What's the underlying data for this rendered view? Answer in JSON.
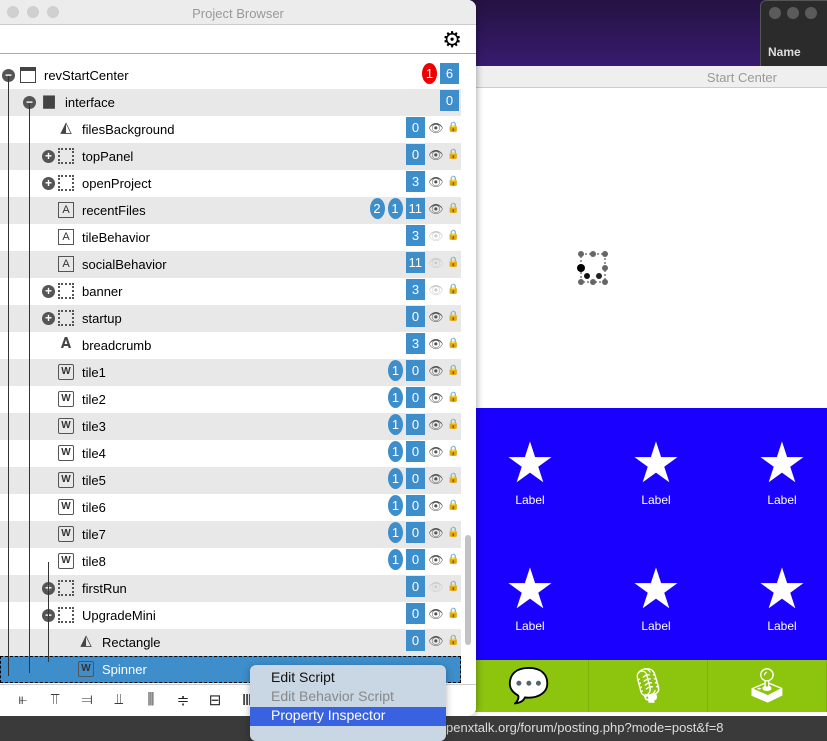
{
  "project_browser": {
    "title": "Project Browser",
    "settings_icon": "gear-icon",
    "rows": [
      {
        "name": "revStartCenter",
        "level": 0,
        "toggle": "minus",
        "icon": "card",
        "overlays": [
          {
            "v": "1",
            "color": "#e00000"
          }
        ],
        "count": "6",
        "eye": null
      },
      {
        "name": "interface",
        "level": 1,
        "toggle": "minus",
        "icon": "folder",
        "overlays": [],
        "count": "0",
        "eye": null
      },
      {
        "name": "filesBackground",
        "level": 2,
        "toggle": null,
        "icon": "image",
        "overlays": [],
        "count": "0",
        "eye": "visible"
      },
      {
        "name": "topPanel",
        "level": 2,
        "toggle": "plus",
        "icon": "group",
        "overlays": [],
        "count": "0",
        "eye": "visible"
      },
      {
        "name": "openProject",
        "level": 2,
        "toggle": "plus",
        "icon": "group",
        "overlays": [],
        "count": "3",
        "eye": "visible"
      },
      {
        "name": "recentFiles",
        "level": 2,
        "toggle": null,
        "icon": "field",
        "overlays": [
          {
            "v": "2"
          },
          {
            "v": "1"
          }
        ],
        "count": "11",
        "eye": "visible"
      },
      {
        "name": "tileBehavior",
        "level": 2,
        "toggle": null,
        "icon": "field",
        "overlays": [],
        "count": "3",
        "eye": "hidden"
      },
      {
        "name": "socialBehavior",
        "level": 2,
        "toggle": null,
        "icon": "field",
        "overlays": [],
        "count": "11",
        "eye": "hidden"
      },
      {
        "name": "banner",
        "level": 2,
        "toggle": "plus",
        "icon": "group",
        "overlays": [],
        "count": "3",
        "eye": "hidden"
      },
      {
        "name": "startup",
        "level": 2,
        "toggle": "plus",
        "icon": "group",
        "overlays": [],
        "count": "0",
        "eye": "visible"
      },
      {
        "name": "breadcrumb",
        "level": 2,
        "toggle": null,
        "icon": "text",
        "overlays": [],
        "count": "3",
        "eye": "visible"
      },
      {
        "name": "tile1",
        "level": 2,
        "toggle": null,
        "icon": "widget",
        "overlays": [
          {
            "v": "1"
          }
        ],
        "count": "0",
        "eye": "visible"
      },
      {
        "name": "tile2",
        "level": 2,
        "toggle": null,
        "icon": "widget",
        "overlays": [
          {
            "v": "1"
          }
        ],
        "count": "0",
        "eye": "visible"
      },
      {
        "name": "tile3",
        "level": 2,
        "toggle": null,
        "icon": "widget",
        "overlays": [
          {
            "v": "1"
          }
        ],
        "count": "0",
        "eye": "visible"
      },
      {
        "name": "tile4",
        "level": 2,
        "toggle": null,
        "icon": "widget",
        "overlays": [
          {
            "v": "1"
          }
        ],
        "count": "0",
        "eye": "visible"
      },
      {
        "name": "tile5",
        "level": 2,
        "toggle": null,
        "icon": "widget",
        "overlays": [
          {
            "v": "1"
          }
        ],
        "count": "0",
        "eye": "visible"
      },
      {
        "name": "tile6",
        "level": 2,
        "toggle": null,
        "icon": "widget",
        "overlays": [
          {
            "v": "1"
          }
        ],
        "count": "0",
        "eye": "visible"
      },
      {
        "name": "tile7",
        "level": 2,
        "toggle": null,
        "icon": "widget",
        "overlays": [
          {
            "v": "1"
          }
        ],
        "count": "0",
        "eye": "visible"
      },
      {
        "name": "tile8",
        "level": 2,
        "toggle": null,
        "icon": "widget",
        "overlays": [
          {
            "v": "1"
          }
        ],
        "count": "0",
        "eye": "visible"
      },
      {
        "name": "firstRun",
        "level": 2,
        "toggle": "plus",
        "icon": "group",
        "overlays": [],
        "count": "0",
        "eye": "hidden"
      },
      {
        "name": "UpgradeMini",
        "level": 2,
        "toggle": "minus",
        "icon": "group",
        "overlays": [],
        "count": "0",
        "eye": "visible"
      },
      {
        "name": "Rectangle",
        "level": 3,
        "toggle": null,
        "icon": "image",
        "overlays": [],
        "count": "0",
        "eye": "visible"
      },
      {
        "name": "Spinner",
        "level": 3,
        "toggle": null,
        "icon": "widget",
        "overlays": [],
        "count": "",
        "eye": null,
        "selected": true
      }
    ]
  },
  "context_menu": {
    "items": [
      {
        "label": "Edit Script",
        "state": "enabled"
      },
      {
        "label": "Edit Behavior Script",
        "state": "disabled"
      },
      {
        "label": "Property Inspector",
        "state": "highlighted"
      }
    ]
  },
  "start_center": {
    "title": "Start Center",
    "tile_labels": [
      "Label",
      "Label",
      "Label",
      "Label",
      "Label",
      "Label"
    ],
    "bottom_icons": [
      "chat-icon",
      "microphone-icon",
      "joystick-icon"
    ]
  },
  "background_window": {
    "column_header": "Name"
  },
  "status_bar": {
    "url": "penxtalk.org/forum/posting.php?mode=post&f=8"
  },
  "colors": {
    "accent": "#3d8ecb",
    "stage_blue": "#1a00ff",
    "stage_green": "#8cc40e",
    "menu_highlight": "#3862e0"
  }
}
